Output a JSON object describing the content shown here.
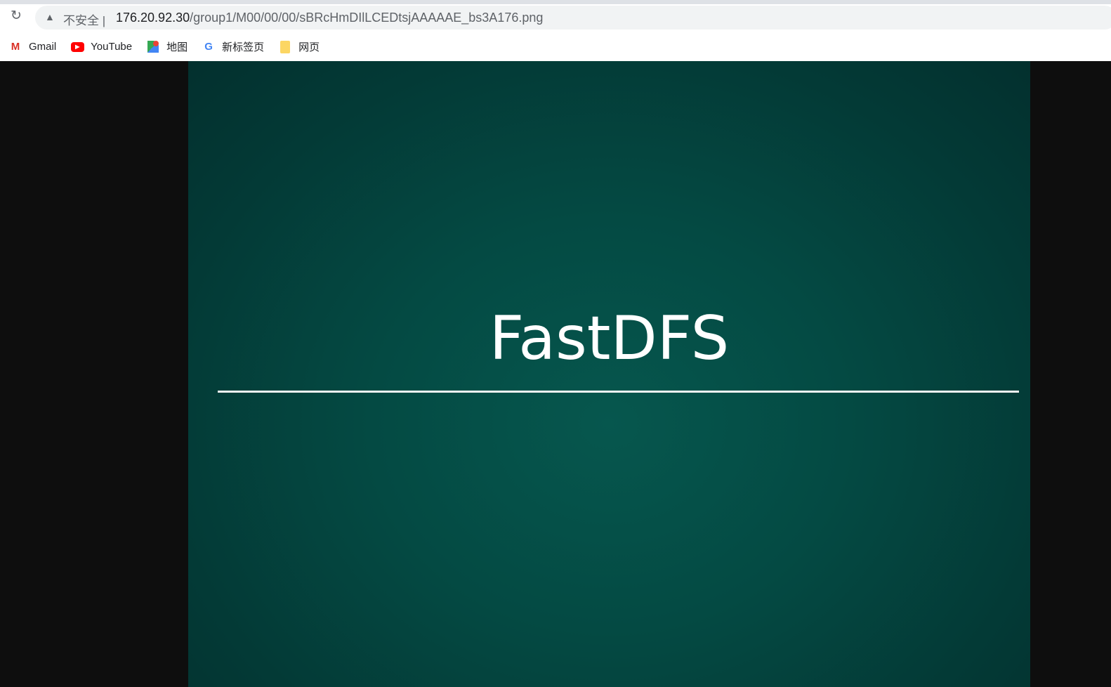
{
  "browser": {
    "address_bar": {
      "security_label": "不安全",
      "host": "176.20.92.30",
      "path": "/group1/M00/00/00/sBRcHmDIlLCEDtsjAAAAAE_bs3A176.png"
    },
    "bookmarks": [
      {
        "label": "Gmail",
        "icon": "gmail-icon"
      },
      {
        "label": "YouTube",
        "icon": "youtube-icon"
      },
      {
        "label": "地图",
        "icon": "maps-icon"
      },
      {
        "label": "新标签页",
        "icon": "google-icon"
      },
      {
        "label": "网页",
        "icon": "folder-icon"
      }
    ]
  },
  "image": {
    "title": "FastDFS",
    "background_color": "#044a43"
  }
}
